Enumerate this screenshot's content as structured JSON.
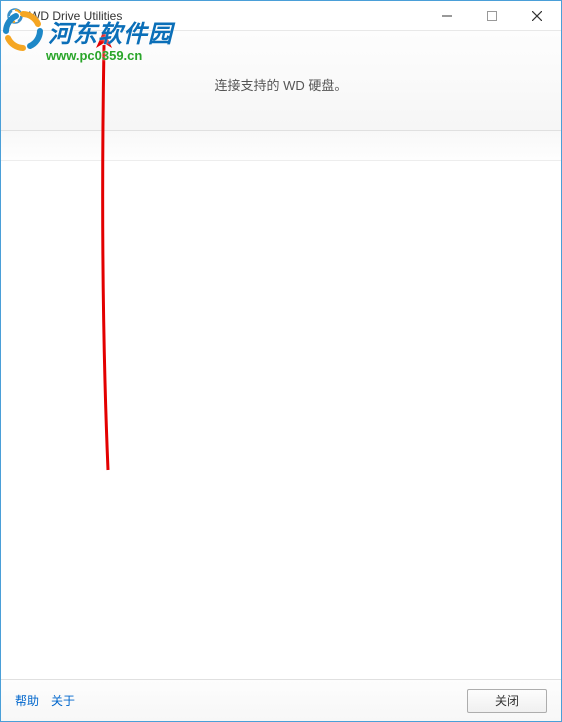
{
  "titlebar": {
    "app_title": "WD Drive Utilities"
  },
  "header": {
    "message": "连接支持的 WD 硬盘。"
  },
  "footer": {
    "help_label": "帮助",
    "about_label": "关于",
    "close_label": "关闭"
  },
  "watermark": {
    "site_name": "河东软件园",
    "site_url": "www.pc0359.cn"
  },
  "colors": {
    "window_border": "#4a9fd8",
    "link": "#0066cc",
    "watermark_text": "#0b6fb8",
    "watermark_url": "#2aa52a",
    "annotation_arrow": "#e30000"
  }
}
